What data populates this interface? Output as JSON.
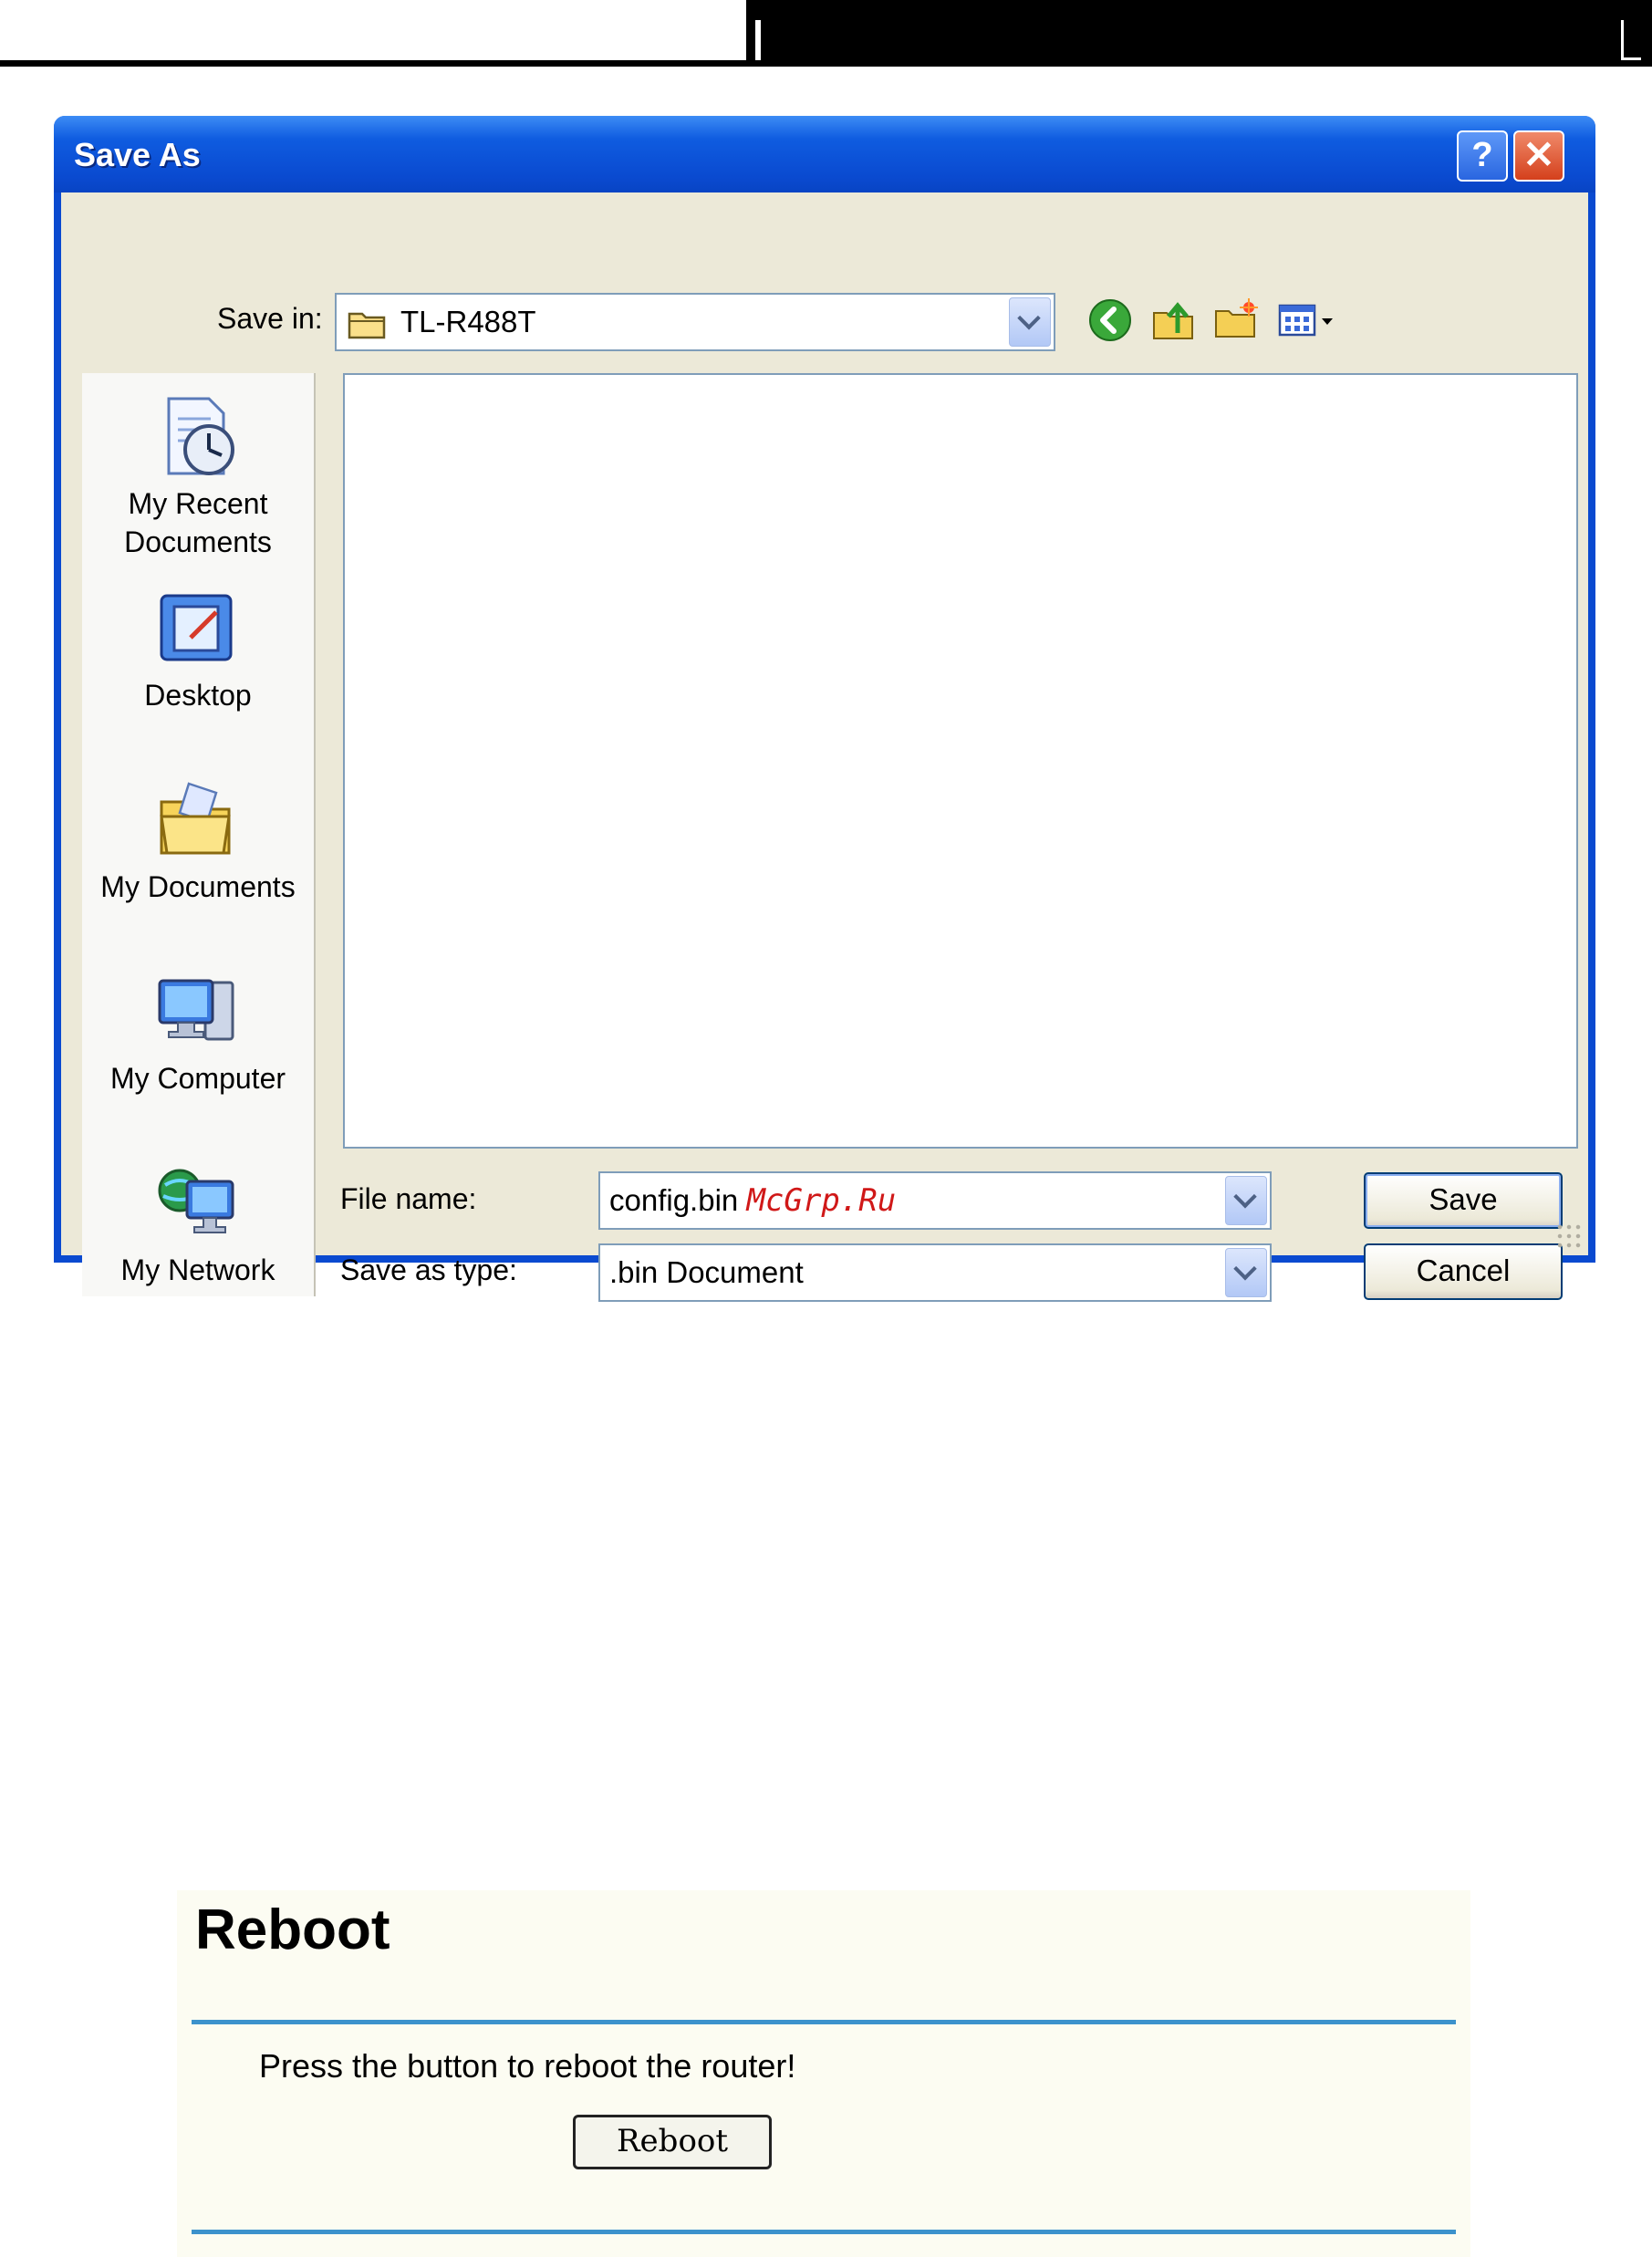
{
  "dialog": {
    "title": "Save As",
    "help_glyph": "?",
    "close_glyph": "✕",
    "save_in_label": "Save in:",
    "save_in_value": "TL-R488T",
    "toolbar_icons": [
      "back-icon",
      "up-folder-icon",
      "new-folder-icon",
      "view-menu-icon"
    ],
    "places": [
      {
        "label_line1": "My Recent",
        "label_line2": "Documents",
        "icon": "recent-documents-icon"
      },
      {
        "label_line1": "Desktop",
        "label_line2": "",
        "icon": "desktop-icon"
      },
      {
        "label_line1": "My Documents",
        "label_line2": "",
        "icon": "my-documents-icon"
      },
      {
        "label_line1": "My Computer",
        "label_line2": "",
        "icon": "my-computer-icon"
      },
      {
        "label_line1": "My Network",
        "label_line2": "",
        "icon": "my-network-icon"
      }
    ],
    "file_name_label": "File name:",
    "file_name_value": "config.bin",
    "watermark": "McGrp.Ru",
    "save_type_label": "Save as type:",
    "save_type_value": ".bin Document",
    "save_button": "Save",
    "cancel_button": "Cancel",
    "colors": {
      "titlebar": "#0a4ad0",
      "client": "#ece9d8",
      "watermark": "#d01818"
    }
  },
  "reboot": {
    "title": "Reboot",
    "message": "Press the button to reboot the router!",
    "button": "Reboot",
    "colors": {
      "rule": "#3c92cc",
      "panel": "#fcfcf2"
    }
  }
}
